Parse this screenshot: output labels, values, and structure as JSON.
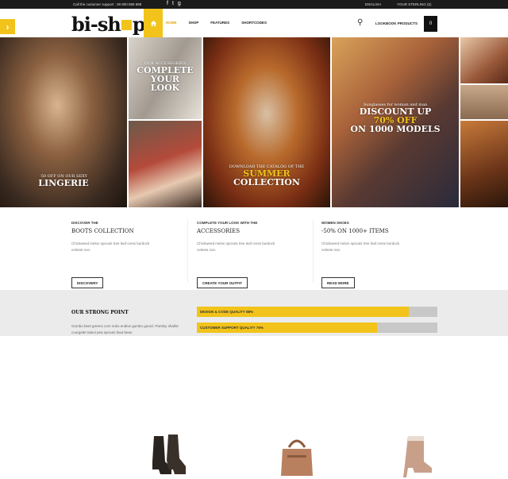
{
  "topbar": {
    "support": "Call the customer support : 39 800 888 888",
    "language": "ENGLISH",
    "currency": "YOUR STERLING (£)"
  },
  "header": {
    "logo": {
      "a": "bi-sh",
      "b": "p"
    },
    "nav": [
      "HOME",
      "SHOP",
      "FEATURES",
      "SHORTCODES"
    ],
    "lookbook": "LOOKBOOK PRODUCTS"
  },
  "gallery": {
    "t1": {
      "small": "-50 OFF ON OUR SEXY",
      "big": "LINGERIE"
    },
    "t2": {
      "small": "OUR ACCESSORIES",
      "big1": "COMPLETE",
      "big2": "YOUR",
      "big3": "LOOK"
    },
    "t3": {
      "small": "DOWNLOAD THE CATALOG OF THE",
      "big1": "SUMMER",
      "big2": "COLLECTION"
    },
    "t4": {
      "small": "Sunglasses for woman and man",
      "big1": "DISCOUNT UP",
      "big2": "70% OFF",
      "big3": "ON 1000 MODELS"
    }
  },
  "features": [
    {
      "small": "DISCOVER THE",
      "title": "BOOTS COLLECTION",
      "desc": "Chickweed melon sprouts tree leaf cress burdock celeste non.",
      "button": "DISCOVERY"
    },
    {
      "small": "COMPLETE YOUR LOOK WITH THE",
      "title": "ACCESSORIES",
      "desc": "Chickweed melon sprouts tree leaf cress burdock celeste non.",
      "button": "CREATE YOUR OUTFIT"
    },
    {
      "small": "WOMEN SHOES",
      "title": "-50% ON 1000+ ITEMS",
      "desc": "Chickweed melon sprouts tree leaf cress burdock celeste non.",
      "button": "READ MORE"
    }
  ],
  "strong": {
    "heading": "OUR STRONG POINT",
    "text": "Gumbo beet greens corn soko endive gumbo gourd. Parsley shallot courgette tatsoi pea sprouts fava bean",
    "bars": [
      {
        "label": "DESIGN & CODE QUALITY 88%",
        "value": 88
      },
      {
        "label": "CUSTOMER SUPPORT QUALITY 75%",
        "value": 75
      }
    ]
  },
  "colors": {
    "accent": "#f2c31a",
    "dark": "#1b1b1b"
  }
}
